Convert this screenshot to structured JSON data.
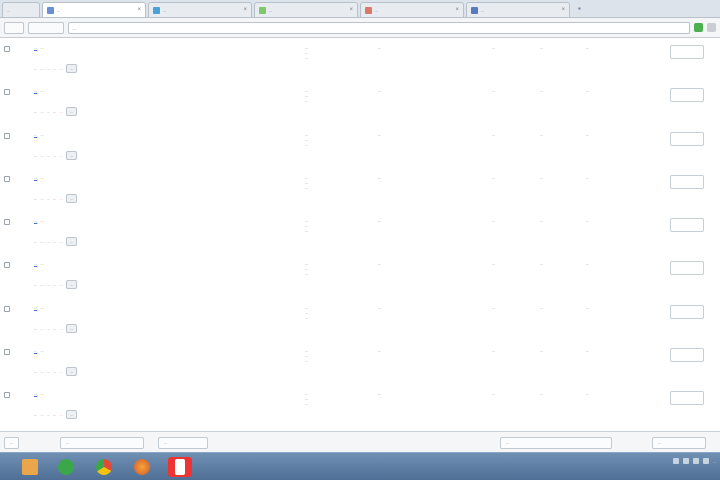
{
  "colors": {
    "link": "#3a6fd0",
    "delete": "#d9534f",
    "taskbar": "#5a7aa2"
  },
  "tabs": [
    {
      "label": "...",
      "icon": "page-icon",
      "active": false
    },
    {
      "label": "...",
      "icon": "page-icon",
      "active": true
    },
    {
      "label": "...",
      "icon": "page-icon",
      "active": false
    },
    {
      "label": "...",
      "icon": "page-icon",
      "active": false
    },
    {
      "label": "...",
      "icon": "page-icon",
      "active": false
    },
    {
      "label": "...",
      "icon": "page-icon",
      "active": false
    }
  ],
  "address": {
    "url": "..."
  },
  "row_actions": {
    "edit": "...",
    "view": "...",
    "approve": "...",
    "history": "...",
    "delete": "...",
    "spam": "..."
  },
  "rows": [
    {
      "title": "...",
      "id": "...",
      "author": [
        "...",
        "...",
        "..."
      ],
      "summary": "...",
      "date": "...",
      "count": "...",
      "status": "..."
    },
    {
      "title": "...",
      "id": "...",
      "author": [
        "...",
        "...",
        "..."
      ],
      "summary": "...",
      "date": "...",
      "count": "...",
      "status": "..."
    },
    {
      "title": "...",
      "id": "...",
      "author": [
        "...",
        "...",
        "..."
      ],
      "summary": "...",
      "date": "...",
      "count": "...",
      "status": "..."
    },
    {
      "title": "...",
      "id": "...",
      "author": [
        "...",
        "...",
        "..."
      ],
      "summary": "...",
      "date": "...",
      "count": "...",
      "status": "..."
    },
    {
      "title": "...",
      "id": "...",
      "author": [
        "...",
        "...",
        "..."
      ],
      "summary": "...",
      "date": "...",
      "count": "...",
      "status": "..."
    },
    {
      "title": "...",
      "id": "...",
      "author": [
        "...",
        "...",
        "..."
      ],
      "summary": "...",
      "date": "...",
      "count": "...",
      "status": "..."
    },
    {
      "title": "...",
      "id": "...",
      "author": [
        "...",
        "...",
        "..."
      ],
      "summary": "...",
      "date": "...",
      "count": "...",
      "status": "..."
    },
    {
      "title": "...",
      "id": "...",
      "author": [
        "...",
        "...",
        "..."
      ],
      "summary": "...",
      "date": "...",
      "count": "...",
      "status": "..."
    },
    {
      "title": "...",
      "id": "...",
      "author": [
        "...",
        "...",
        "..."
      ],
      "summary": "...",
      "date": "...",
      "count": "...",
      "status": "..."
    }
  ],
  "bottom": {
    "btn1": "...",
    "btn2": "...",
    "btn3": "...",
    "btn4": "...",
    "btn5": "..."
  },
  "taskbar": {
    "apps": [
      {
        "name": "windows-explorer-icon"
      },
      {
        "name": "green-app-icon"
      },
      {
        "name": "chrome-icon"
      },
      {
        "name": "firefox-icon"
      },
      {
        "name": "yandex-icon"
      }
    ],
    "clock": "..."
  }
}
